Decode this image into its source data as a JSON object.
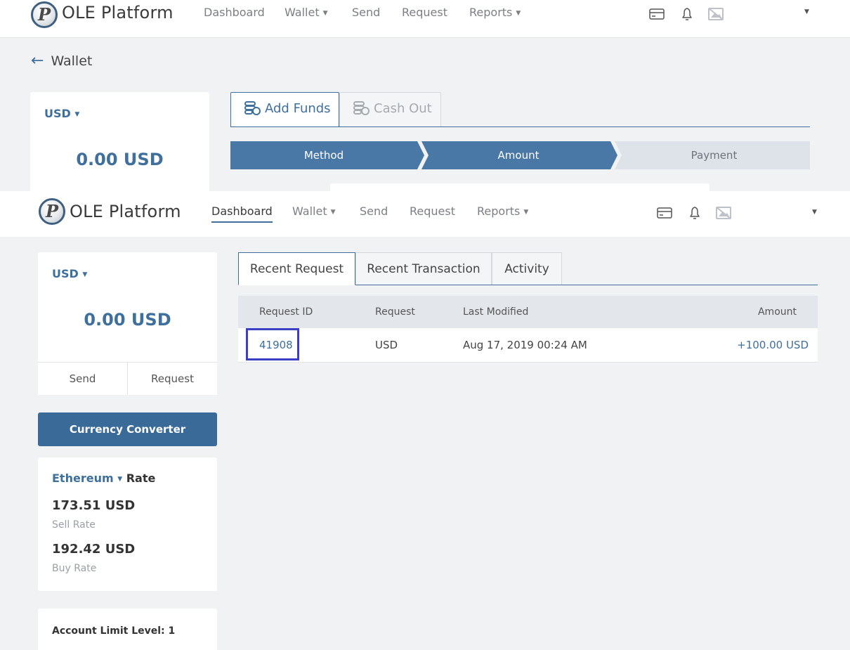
{
  "brand": "OLE Platform",
  "logo_letter": "P",
  "nav": [
    "Dashboard",
    "Wallet",
    "Send",
    "Request",
    "Reports"
  ],
  "wallet_page": {
    "title": "Wallet",
    "currency": "USD",
    "balance": "0.00 USD",
    "tabs": {
      "add_funds": "Add Funds",
      "cash_out": "Cash Out"
    },
    "steps": [
      "Method",
      "Amount",
      "Payment"
    ]
  },
  "dashboard": {
    "currency": "USD",
    "balance": "0.00 USD",
    "send_label": "Send",
    "request_label": "Request",
    "converter_label": "Currency Converter",
    "rate": {
      "asset": "Ethereum",
      "suffix": "Rate",
      "sell_value": "173.51 USD",
      "sell_label": "Sell Rate",
      "buy_value": "192.42 USD",
      "buy_label": "Buy Rate"
    },
    "limit_label": "Account Limit Level: 1",
    "tabs": [
      "Recent Request",
      "Recent Transaction",
      "Activity"
    ],
    "table": {
      "headers": [
        "Request ID",
        "Request",
        "Last Modified",
        "Amount"
      ],
      "rows": [
        {
          "id": "41908",
          "request": "USD",
          "modified": "Aug 17, 2019 00:24 AM",
          "amount": "+100.00 USD"
        }
      ]
    }
  },
  "colors": {
    "accent": "#3f6f9d",
    "step_active": "#4a78a6",
    "step_inactive": "#dde3e9",
    "highlight": "#3b3fc4"
  }
}
